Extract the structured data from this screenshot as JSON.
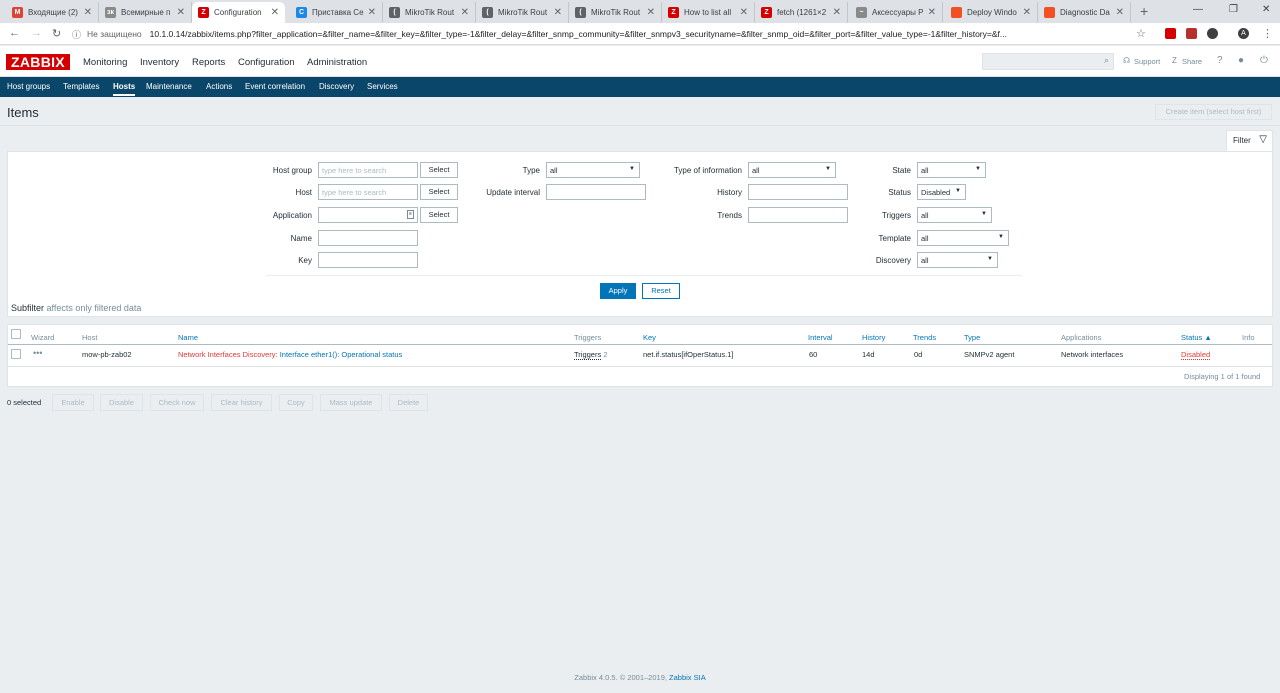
{
  "browser": {
    "tabs": [
      {
        "label": "Входящие (2)",
        "color": "#db4437",
        "glyph": "M",
        "active": false
      },
      {
        "label": "Всемирные п",
        "color": "#8a8a8a",
        "glyph": "зк",
        "active": false
      },
      {
        "label": "Configuration",
        "color": "#d40000",
        "glyph": "Z",
        "active": true
      },
      {
        "label": "Приставка Се",
        "color": "#1e88e5",
        "glyph": "C",
        "active": false
      },
      {
        "label": "MikroTik Rout",
        "color": "#5f6368",
        "glyph": "(",
        "active": false
      },
      {
        "label": "MikroTik Rout",
        "color": "#5f6368",
        "glyph": "(",
        "active": false
      },
      {
        "label": "MikroTik Rout",
        "color": "#5f6368",
        "glyph": "(",
        "active": false
      },
      {
        "label": "How to list all",
        "color": "#d40000",
        "glyph": "Z",
        "active": false
      },
      {
        "label": "fetch (1261×2",
        "color": "#d40000",
        "glyph": "Z",
        "active": false
      },
      {
        "label": "Аксессуары Р",
        "color": "#8a8a8a",
        "glyph": "~",
        "active": false
      },
      {
        "label": "Deploy Windo",
        "color": "#f25022",
        "glyph": "",
        "active": false
      },
      {
        "label": "Diagnostic Da",
        "color": "#f25022",
        "glyph": "",
        "active": false
      }
    ],
    "security_label": "Не защищено",
    "url": "10.1.0.14/zabbix/items.php?filter_application=&filter_name=&filter_key=&filter_type=-1&filter_delay=&filter_snmp_community=&filter_snmpv3_securityname=&filter_snmp_oid=&filter_port=&filter_value_type=-1&filter_history=&f..."
  },
  "header": {
    "logo": "ZABBIX",
    "menu": [
      "Monitoring",
      "Inventory",
      "Reports",
      "Configuration",
      "Administration"
    ],
    "support": "Support",
    "share": "Share",
    "help": "?"
  },
  "submenu": [
    "Host groups",
    "Templates",
    "Hosts",
    "Maintenance",
    "Actions",
    "Event correlation",
    "Discovery",
    "Services"
  ],
  "page": {
    "title": "Items",
    "create_button": "Create item (select host first)"
  },
  "filter": {
    "tab_label": "Filter",
    "host_group_label": "Host group",
    "host_group_placeholder": "type here to search",
    "host_label": "Host",
    "host_placeholder": "type here to search",
    "application_label": "Application",
    "name_label": "Name",
    "key_label": "Key",
    "select_label": "Select",
    "type_label": "Type",
    "type_value": "all",
    "update_interval_label": "Update interval",
    "type_of_info_label": "Type of information",
    "type_of_info_value": "all",
    "history_label": "History",
    "trends_label": "Trends",
    "state_label": "State",
    "state_value": "all",
    "status_label": "Status",
    "status_value": "Disabled",
    "triggers_label": "Triggers",
    "triggers_value": "all",
    "template_label": "Template",
    "template_value": "all",
    "discovery_label": "Discovery",
    "discovery_value": "all",
    "apply": "Apply",
    "reset": "Reset",
    "subfilter": "Subfilter",
    "subfilter_note": "affects only filtered data"
  },
  "table": {
    "headers": {
      "wizard": "Wizard",
      "host": "Host",
      "name": "Name",
      "triggers": "Triggers",
      "key": "Key",
      "interval": "Interval",
      "history": "History",
      "trends": "Trends",
      "type": "Type",
      "applications": "Applications",
      "status": "Status ▲",
      "info": "Info"
    },
    "row": {
      "wizard": "•••",
      "host": "mow-pb-zab02",
      "name_prefix": "Network Interfaces Discovery:",
      "name": "Interface ether1(): Operational status",
      "triggers": "Triggers",
      "triggers_count": "2",
      "key": "net.if.status[ifOperStatus.1]",
      "interval": "60",
      "history": "14d",
      "trends": "0d",
      "type": "SNMPv2 agent",
      "applications": "Network interfaces",
      "status": "Disabled"
    },
    "displaying": "Displaying 1 of 1 found"
  },
  "actions": {
    "selected": "0 selected",
    "buttons": [
      "Enable",
      "Disable",
      "Check now",
      "Clear history",
      "Copy",
      "Mass update",
      "Delete"
    ]
  },
  "footer": {
    "text": "Zabbix 4.0.5. © 2001–2019,",
    "company": "Zabbix SIA"
  },
  "colors": {
    "brand": "#d40000",
    "nav": "#0a466a",
    "link": "#0275b8",
    "disabled": "#e33734"
  }
}
